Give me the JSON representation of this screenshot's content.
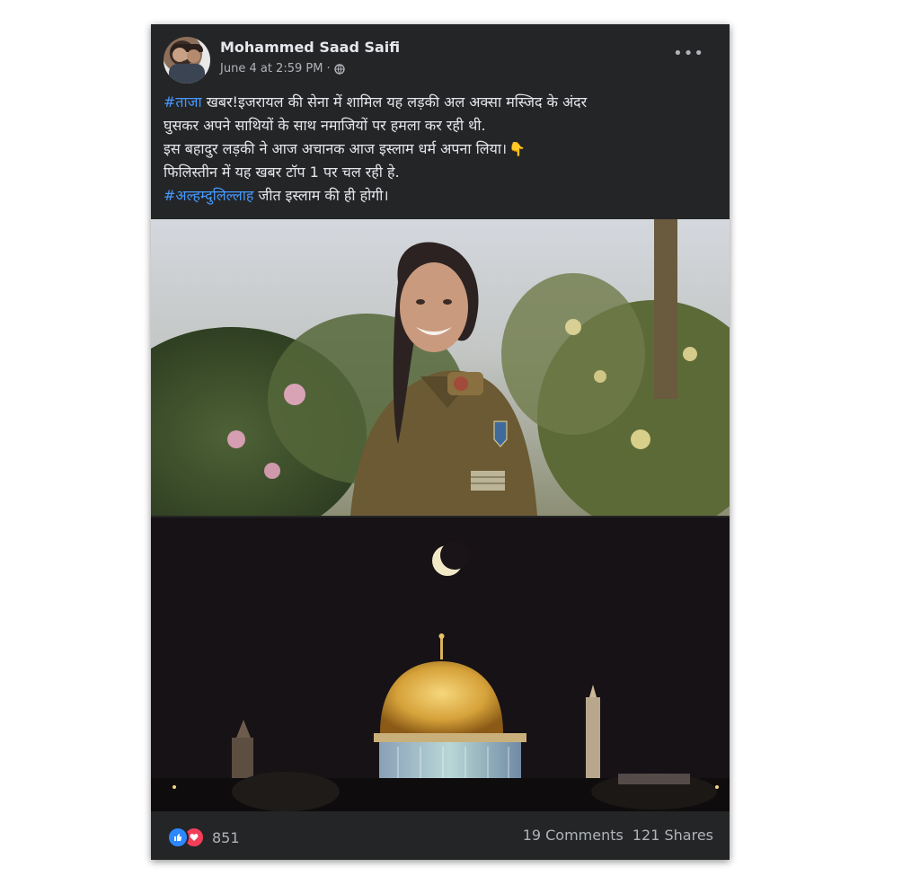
{
  "post": {
    "author": "Mohammed Saad Saifi",
    "timestamp": "June 4 at 2:59 PM",
    "separator": "·",
    "more_label": "•••",
    "text": {
      "hashtag1": "#ताजा",
      "line1_rest": " खबर!इजरायल की सेना में शामिल यह लड़की अल अक्सा मस्जिद के अंदर",
      "line2": "घुसकर अपने साथियों के साथ नमाजियों पर हमला कर रही थी.",
      "line3": "इस बहादुर लड़की ने आज अचानक आज इस्लाम धर्म अपना लिया।",
      "line4": "फिलिस्तीन में यह खबर टॉप 1 पर चल रही हे.",
      "hashtag2": "#अल्हम्दुलिल्लाह",
      "line5_rest": " जीत इस्लाम की ही होगी।"
    },
    "icons": {
      "privacy": "globe-icon",
      "emoji": "pointing-down-icon",
      "reaction1": "like-icon",
      "reaction2": "love-icon"
    },
    "colors": {
      "background": "#242526",
      "hashtag": "#4599ff",
      "like": "#2d88ff",
      "love": "#f33e58"
    },
    "reaction_count": "851",
    "comments": "19 Comments",
    "shares": "121 Shares"
  }
}
